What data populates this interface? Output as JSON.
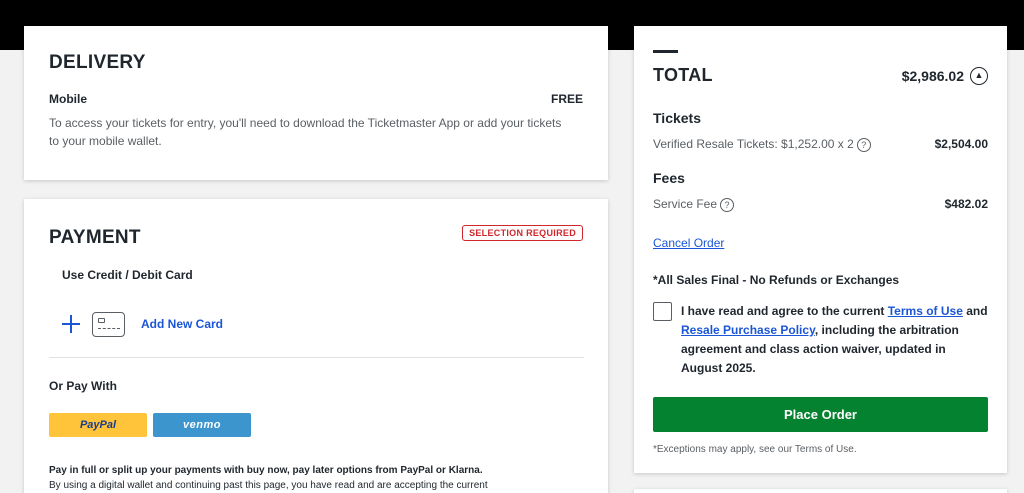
{
  "delivery": {
    "title": "DELIVERY",
    "method": "Mobile",
    "price": "FREE",
    "description": "To access your tickets for entry, you'll need to download the Ticketmaster App or add your tickets to your mobile wallet."
  },
  "payment": {
    "title": "PAYMENT",
    "badge": "SELECTION REQUIRED",
    "use_card_label": "Use Credit / Debit Card",
    "add_card_label": "Add New Card",
    "or_pay_label": "Or Pay With",
    "paypal_label": "PayPal",
    "venmo_label": "venmo",
    "note_bold": "Pay in full or split up your payments with buy now, pay later options from PayPal or Klarna.",
    "note_text": "By using a digital wallet and continuing past this page, you have read and are accepting the current"
  },
  "total": {
    "title": "TOTAL",
    "amount": "$2,986.02",
    "tickets_title": "Tickets",
    "tickets_line": "Verified Resale Tickets: $1,252.00 x 2",
    "tickets_amount": "$2,504.00",
    "fees_title": "Fees",
    "fee_line": "Service Fee",
    "fee_amount": "$482.02",
    "cancel_label": "Cancel Order",
    "final_note": "*All Sales Final - No Refunds or Exchanges",
    "agree_prefix": "I have read and agree to the current ",
    "terms_link": "Terms of Use",
    "agree_and": " and ",
    "resale_link": "Resale Purchase Policy",
    "agree_suffix": ", including the arbitration agreement and class action waiver, updated in August 2025.",
    "place_order_label": "Place Order",
    "exceptions": "*Exceptions may apply, see our Terms of Use."
  },
  "colors": {
    "link": "#1a56d6",
    "place_order": "#05822f",
    "badge": "#d0262c",
    "paypal": "#ffc43a",
    "venmo": "#3d95ce"
  }
}
